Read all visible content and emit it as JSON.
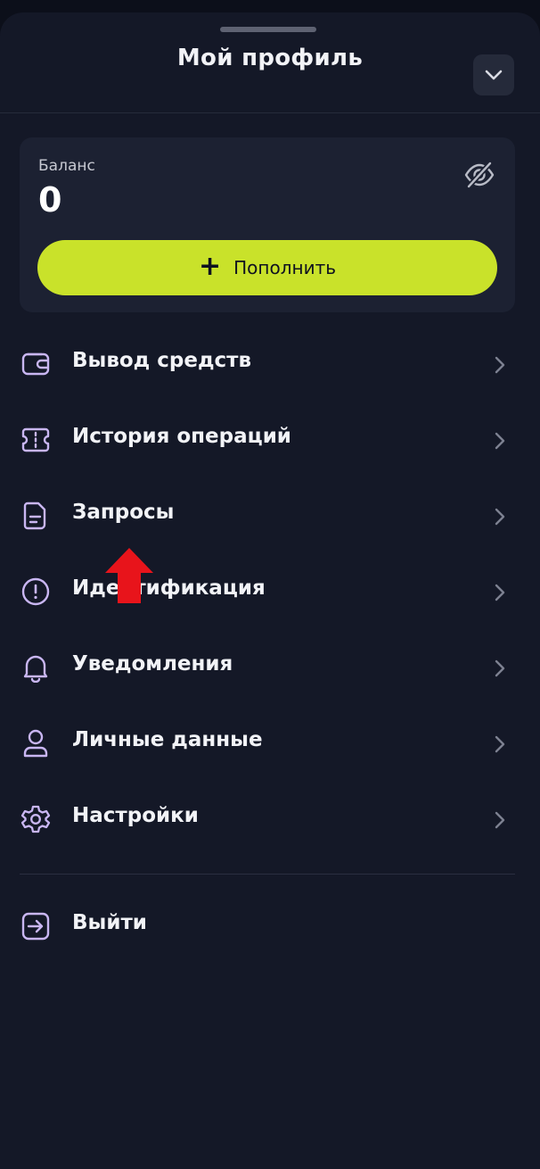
{
  "header": {
    "title": "Мой профиль"
  },
  "balance": {
    "label": "Баланс",
    "value": "0",
    "topup_label": "Пополнить"
  },
  "menu": {
    "items": [
      {
        "label": "Вывод средств",
        "icon": "wallet-icon"
      },
      {
        "label": "История операций",
        "icon": "ticket-icon"
      },
      {
        "label": "Запросы",
        "icon": "document-icon"
      },
      {
        "label": "Идентификация",
        "icon": "alert-circle-icon"
      },
      {
        "label": "Уведомления",
        "icon": "bell-icon"
      },
      {
        "label": "Личные данные",
        "icon": "user-icon"
      },
      {
        "label": "Настройки",
        "icon": "gear-icon"
      }
    ],
    "logout_label": "Выйти"
  },
  "colors": {
    "background": "#0c0f1a",
    "sheet": "#141827",
    "card": "#1c2132",
    "accent": "#c9e22a",
    "icon_stroke": "#c9b6f2",
    "annotation_arrow": "#e8141b"
  }
}
